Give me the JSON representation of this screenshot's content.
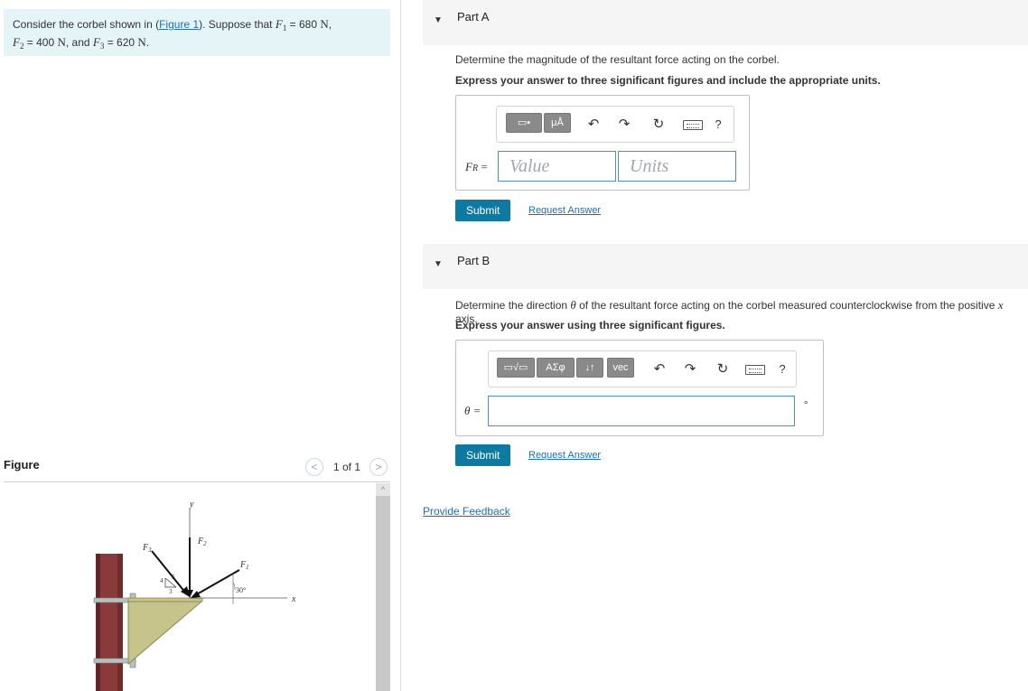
{
  "problem": {
    "text_intro": "Consider the corbel shown in (",
    "figure_link": "Figure 1",
    "text_after_link": "). Suppose that ",
    "f1_symbol": "F",
    "f1_sub": "1",
    "f1_value": " = 680",
    "unit_n": "N",
    "sep1": ",",
    "f2_symbol": "F",
    "f2_sub": "2",
    "f2_value": " = 400",
    "sep2": ", and ",
    "f3_symbol": "F",
    "f3_sub": "3",
    "f3_value": " = 620",
    "sep3": "."
  },
  "figure": {
    "label": "Figure",
    "counter": "1 of 1",
    "prev_glyph": "<",
    "next_glyph": ">",
    "scroll_up_glyph": "^",
    "labels": {
      "y_axis": "y",
      "x_axis": "x",
      "f1": "F",
      "f1_sub": "1",
      "f2": "F",
      "f2_sub": "2",
      "f3": "F",
      "f3_sub": "3",
      "slope_4": "4",
      "slope_5": "5",
      "slope_3": "3",
      "angle": "30°"
    },
    "colors": {
      "column": "#8a3a3a",
      "column_dark": "#5e2626",
      "bracket": "#c6c48a",
      "bolt": "#b8c0c0"
    }
  },
  "partA": {
    "title": "Part A",
    "toggle_glyph": "▼",
    "prompt": "Determine the magnitude of the resultant force acting on the corbel.",
    "instruction": "Express your answer to three significant figures and include the appropriate units.",
    "toolbar": {
      "template_btn": "▭▪",
      "units_btn": "μÅ",
      "help": "?"
    },
    "var_label": "F",
    "var_sub": "R",
    "equals": "=",
    "value_placeholder": "Value",
    "units_placeholder": "Units",
    "submit_label": "Submit",
    "request_label": "Request Answer"
  },
  "partB": {
    "title": "Part B",
    "toggle_glyph": "▼",
    "prompt_before": "Determine the direction ",
    "theta": "θ",
    "prompt_after": " of the resultant force acting on the corbel measured counterclockwise from the positive ",
    "x_var": "x",
    "prompt_end": " axis.",
    "instruction": "Express your answer using three significant figures.",
    "toolbar": {
      "sqrt_btn": "▭√▭",
      "greek_btn": "ΑΣφ",
      "updown_btn": "↓↑",
      "vec_btn": "vec",
      "help": "?"
    },
    "var_label": "θ =",
    "degree_unit": "°",
    "submit_label": "Submit",
    "request_label": "Request Answer"
  },
  "feedback_label": "Provide Feedback",
  "colors": {
    "accent": "#0e7aa0",
    "link": "#1f6fb2",
    "problem_bg": "#e4f4f7",
    "part_header_bg": "#f5f5f5",
    "field_border": "#4f8fbf"
  }
}
